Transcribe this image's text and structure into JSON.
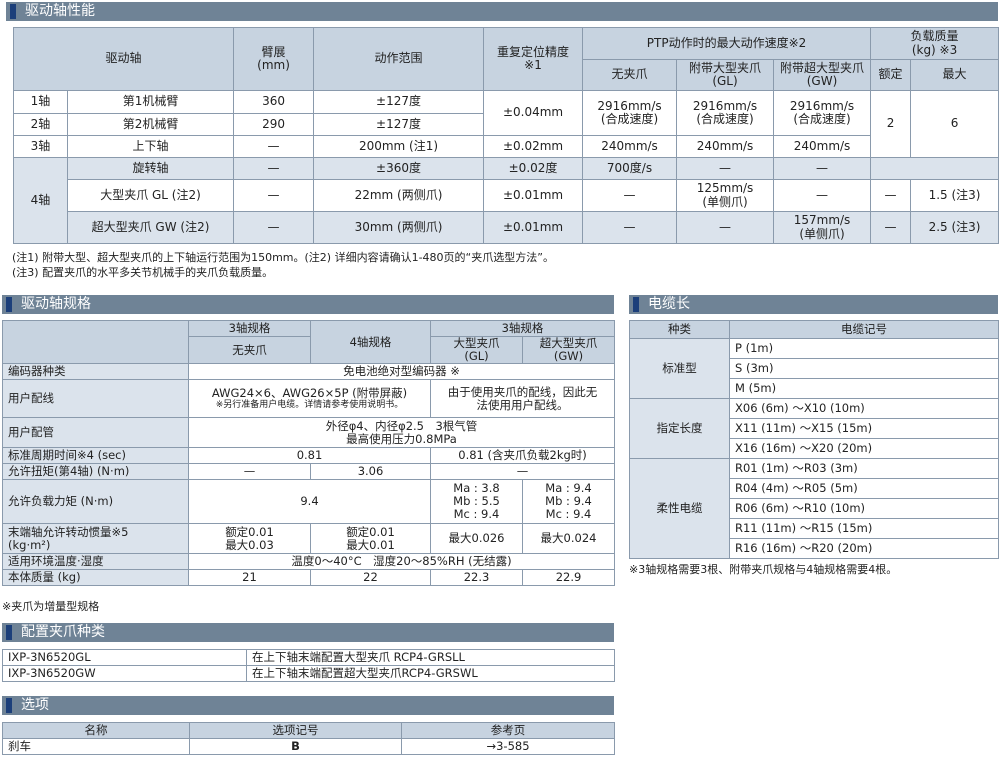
{
  "perf": {
    "header": "驱动轴性能",
    "cols": {
      "axis": "驱动轴",
      "arm": "臂展\n(mm)",
      "range": "动作范围",
      "repeat": "重复定位精度\n※1",
      "ptp": "PTP动作时的最大动作速度※2",
      "no_grip": "无夹爪",
      "gl": "附带大型夹爪\n(GL)",
      "gw": "附带超大型夹爪\n(GW)",
      "load": "负载质量\n(kg) ※3",
      "rated": "额定",
      "max": "最大"
    },
    "rows": {
      "a1": {
        "no": "1轴",
        "name": "第1机械臂",
        "arm": "360",
        "range": "±127度"
      },
      "a2": {
        "no": "2轴",
        "name": "第2机械臂",
        "arm": "290",
        "range": "±127度"
      },
      "a12": {
        "repeat": "±0.04mm",
        "no_grip": "2916mm/s\n(合成速度)",
        "gl": "2916mm/s\n(合成速度)",
        "gw": "2916mm/s\n(合成速度)"
      },
      "load": {
        "rated": "2",
        "max": "6"
      },
      "a3": {
        "no": "3轴",
        "name": "上下轴",
        "arm": "—",
        "range": "200mm (注1)",
        "repeat": "±0.02mm",
        "no_grip": "240mm/s",
        "gl": "240mm/s",
        "gw": "240mm/s"
      },
      "a4": {
        "no": "4轴"
      },
      "a4r": {
        "name": "旋转轴",
        "arm": "—",
        "range": "±360度",
        "repeat": "±0.02度",
        "no_grip": "700度/s",
        "gl": "—",
        "gw": "—"
      },
      "a4gl": {
        "name": "大型夹爪 GL (注2)",
        "arm": "—",
        "range": "22mm (两侧爪)",
        "repeat": "±0.01mm",
        "no_grip": "—",
        "gl": "125mm/s\n(单侧爪)",
        "gw": "—",
        "rated": "—",
        "max": "1.5 (注3)"
      },
      "a4gw": {
        "name": "超大型夹爪 GW (注2)",
        "arm": "—",
        "range": "30mm (两侧爪)",
        "repeat": "±0.01mm",
        "no_grip": "—",
        "gl": "—",
        "gw": "157mm/s\n(单侧爪)",
        "rated": "—",
        "max": "2.5 (注3)"
      }
    },
    "notes": [
      "(注1) 附带大型、超大型夹爪的上下轴运行范围为150mm。(注2) 详细内容请确认1-480页的“夹爪选型方法”。",
      "(注3) 配置夹爪的水平多关节机械手的夹爪负载质量。"
    ]
  },
  "spec": {
    "header": "驱动轴规格",
    "h3axis": "3轴规格",
    "h4axis": "4轴规格",
    "h3axis2": "3轴规格",
    "no_grip": "无夹爪",
    "gl": "大型夹爪\n(GL)",
    "gw": "超大型夹爪\n(GW)",
    "r_encoder": {
      "label": "编码器种类",
      "value": "免电池绝对型编码器 ※"
    },
    "r_wiring": {
      "label": "用户配线",
      "value_a": "AWG24×6、AWG26×5P (附带屏蔽)",
      "value_a_small": "※另行准备用户电缆。详情请参考使用说明书。",
      "value_b": "由于使用夹爪的配线，因此无\n法使用用户配线。"
    },
    "r_pipe": {
      "label": "用户配管",
      "value": "外径φ4、内径φ2.5　3根气管\n最高使用压力0.8MPa"
    },
    "r_cycle": {
      "label": "标准周期时间※4 (sec)",
      "value_a": "0.81",
      "value_b": "0.81 (含夹爪负载2kg时)"
    },
    "r_torque": {
      "label": "允许扭矩(第4轴) (N·m)",
      "c1": "—",
      "c2": "3.06",
      "c3": "—"
    },
    "r_load": {
      "label": "允许负载力矩 (N·m)",
      "value_a": "9.4",
      "gl": "Ma : 3.8\nMb : 5.5\nMc : 9.4",
      "gw": "Ma : 9.4\nMb : 9.4\nMc : 9.4"
    },
    "r_inertia": {
      "label": "末端轴允许转动惯量※5\n(kg·m²)",
      "c1": "额定0.01\n最大0.03",
      "c2": "额定0.01\n最大0.01",
      "c3": "最大0.026",
      "c4": "最大0.024"
    },
    "r_env": {
      "label": "适用环境温度·湿度",
      "value": "温度0～40°C　湿度20～85%RH (无结露)"
    },
    "r_mass": {
      "label": "本体质量 (kg)",
      "c1": "21",
      "c2": "22",
      "c3": "22.3",
      "c4": "22.9"
    },
    "note": "※夹爪为增量型规格"
  },
  "cable": {
    "header": "电缆长",
    "h_type": "种类",
    "h_code": "电缆记号",
    "groups": {
      "std": {
        "label": "标准型",
        "items": [
          "P (1m)",
          "S (3m)",
          "M (5m)"
        ]
      },
      "spec": {
        "label": "指定长度",
        "items": [
          "X06 (6m) ～X10 (10m)",
          "X11 (11m) ～X15 (15m)",
          "X16 (16m) ～X20 (20m)"
        ]
      },
      "flex": {
        "label": "柔性电缆",
        "items": [
          "R01 (1m) ～R03 (3m)",
          "R04 (4m) ～R05 (5m)",
          "R06 (6m) ～R10 (10m)",
          "R11 (11m) ～R15 (15m)",
          "R16 (16m) ～R20 (20m)"
        ]
      }
    },
    "note": "※3轴规格需要3根、附带夹爪规格与4轴规格需要4根。"
  },
  "gripper": {
    "header": "配置夹爪种类",
    "rows": [
      {
        "model": "IXP-3N6520GL",
        "desc": "在上下轴末端配置大型夹爪 RCP4-GRSLL"
      },
      {
        "model": "IXP-3N6520GW",
        "desc": "在上下轴末端配置超大型夹爪RCP4-GRSWL"
      }
    ]
  },
  "options": {
    "header": "选项",
    "h_name": "名称",
    "h_code": "选项记号",
    "h_ref": "参考页",
    "row": {
      "name": "刹车",
      "code": "B",
      "ref": "→3-585"
    }
  }
}
